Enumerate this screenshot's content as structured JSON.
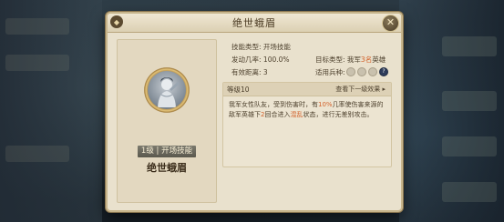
{
  "dialog": {
    "title": "绝世蛾眉",
    "close_glyph": "✕"
  },
  "skill": {
    "level_tag": "1级 | 开场技能",
    "name": "绝世蛾眉",
    "icon": "woman-with-fan-portrait"
  },
  "info": {
    "type_label": "技能类型:",
    "type_value": "开场技能",
    "rate_label": "发动几率:",
    "rate_value": "100.0%",
    "target_label": "目标类型:",
    "target_prefix": "我军",
    "target_count": "3名",
    "target_suffix": "英雄",
    "range_label": "有效距离:",
    "range_value": "3",
    "troop_label": "适用兵种:"
  },
  "description": {
    "level": "等级10",
    "next_level": "查看下一级效果 ▸",
    "text_1": "我军女性队友，受到伤害时，有",
    "text_rate": "10%",
    "text_2": "几率使伤害来源的敌军英雄下",
    "text_turns": "2",
    "text_3": "回合进入",
    "text_status": "混乱",
    "text_4": "状态，进行无差别攻击。"
  },
  "colors": {
    "highlight": "#d2612a",
    "panel": "#e9e1cd"
  }
}
